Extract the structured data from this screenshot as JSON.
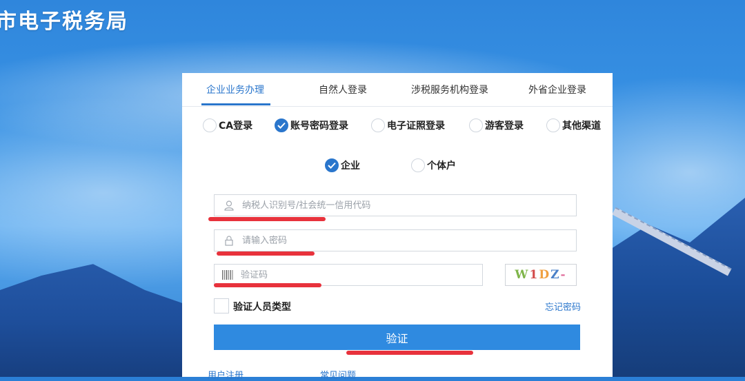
{
  "header": {
    "site_title": "市电子税务局"
  },
  "tabs": [
    {
      "label": "企业业务办理",
      "active": true
    },
    {
      "label": "自然人登录",
      "active": false
    },
    {
      "label": "涉税服务机构登录",
      "active": false
    },
    {
      "label": "外省企业登录",
      "active": false
    }
  ],
  "login_methods": [
    {
      "label": "CA登录",
      "checked": false
    },
    {
      "label": "账号密码登录",
      "checked": true
    },
    {
      "label": "电子证照登录",
      "checked": false
    },
    {
      "label": "游客登录",
      "checked": false
    },
    {
      "label": "其他渠道",
      "checked": false
    }
  ],
  "taxpayer_types": [
    {
      "label": "企业",
      "checked": true
    },
    {
      "label": "个体户",
      "checked": false
    }
  ],
  "form": {
    "taxid_placeholder": "纳税人识别号/社会统一信用代码",
    "password_placeholder": "请输入密码",
    "captcha_placeholder": "验证码",
    "captcha_chars": [
      "W",
      "1",
      "D",
      "Z",
      "-"
    ],
    "verify_type_label": "验证人员类型",
    "forgot_password": "忘记密码",
    "submit_label": "验证"
  },
  "footer_links": {
    "register": "用户注册",
    "faq": "常见问题"
  },
  "colors": {
    "accent": "#2a76cc",
    "submit_bg": "#2f8ae0",
    "annotation_red": "#e8323c"
  }
}
